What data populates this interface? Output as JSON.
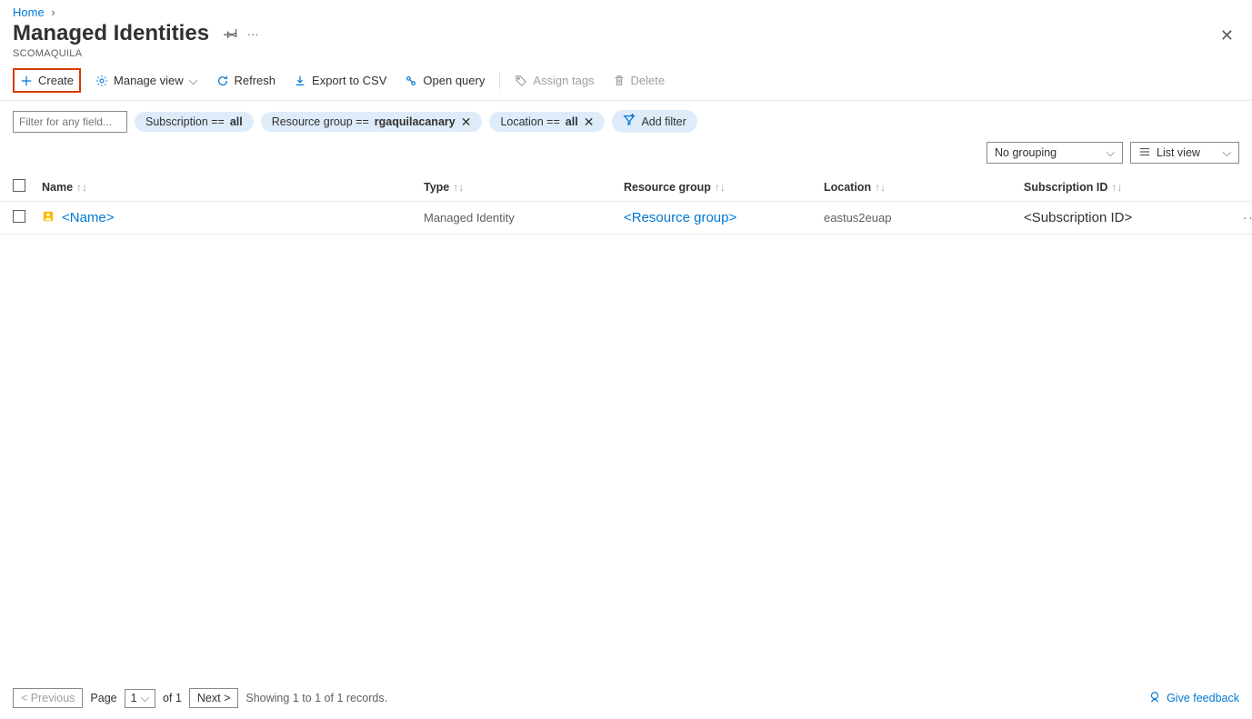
{
  "breadcrumb": {
    "home": "Home"
  },
  "header": {
    "title": "Managed Identities",
    "subtitle": "SCOMAQUILA"
  },
  "toolbar": {
    "create": "Create",
    "manage_view": "Manage view",
    "refresh": "Refresh",
    "export_csv": "Export to CSV",
    "open_query": "Open query",
    "assign_tags": "Assign tags",
    "delete": "Delete"
  },
  "filters": {
    "placeholder": "Filter for any field...",
    "subscription_label": "Subscription == ",
    "subscription_value": "all",
    "resource_group_label": "Resource group == ",
    "resource_group_value": "rgaquilacanary",
    "location_label": "Location == ",
    "location_value": "all",
    "add_filter": "Add filter"
  },
  "view": {
    "grouping": "No grouping",
    "list_view": "List view"
  },
  "columns": {
    "name": "Name",
    "type": "Type",
    "resource_group": "Resource group",
    "location": "Location",
    "subscription_id": "Subscription ID"
  },
  "rows": [
    {
      "name": "<Name>",
      "type": "Managed Identity",
      "resource_group": "<Resource group>",
      "location": "eastus2euap",
      "subscription_id": "<Subscription ID>"
    }
  ],
  "pagination": {
    "previous": "< Previous",
    "page_label": "Page",
    "page_value": "1",
    "of_label": "of 1",
    "next": "Next >",
    "summary": "Showing 1 to 1 of 1 records."
  },
  "footer": {
    "feedback": "Give feedback"
  }
}
